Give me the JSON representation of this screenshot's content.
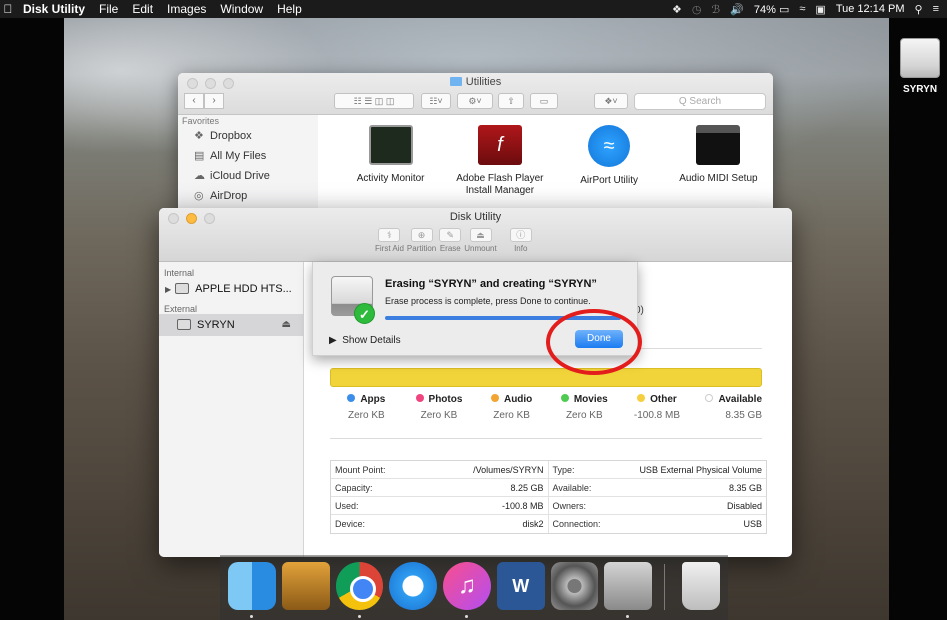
{
  "menubar": {
    "app_name": "Disk Utility",
    "menus": [
      "File",
      "Edit",
      "Images",
      "Window",
      "Help"
    ],
    "battery": "74%",
    "clock": "Tue 12:14 PM"
  },
  "desktop": {
    "drive_label": "SYRYN"
  },
  "finder": {
    "title": "Utilities",
    "search_placeholder": "Q Search",
    "sidebar_header": "Favorites",
    "sidebar_items": [
      "Dropbox",
      "All My Files",
      "iCloud Drive",
      "AirDrop"
    ],
    "apps": [
      {
        "name": "Activity Monitor"
      },
      {
        "name": "Adobe Flash Player Install Manager"
      },
      {
        "name": "AirPort Utility"
      },
      {
        "name": "Audio MIDI Setup"
      }
    ]
  },
  "disk_utility": {
    "title": "Disk Utility",
    "toolbar": [
      "First Aid",
      "Partition",
      "Erase",
      "Unmount",
      "Info"
    ],
    "sidebar": {
      "internal_header": "Internal",
      "internal_device": "APPLE HDD HTS...",
      "external_header": "External",
      "external_device": "SYRYN"
    },
    "legend": [
      {
        "name": "Apps",
        "value": "Zero KB",
        "color": "#3b8eea"
      },
      {
        "name": "Photos",
        "value": "Zero KB",
        "color": "#f0457f"
      },
      {
        "name": "Audio",
        "value": "Zero KB",
        "color": "#f3a531"
      },
      {
        "name": "Movies",
        "value": "Zero KB",
        "color": "#4fcb52"
      },
      {
        "name": "Other",
        "value": "-100.8 MB",
        "color": "#f6cf3e"
      },
      {
        "name": "Available",
        "value": "8.35 GB",
        "color": "#ffffff"
      }
    ],
    "info": {
      "mount_point_label": "Mount Point:",
      "mount_point": "/Volumes/SYRYN",
      "type_label": "Type:",
      "type": "USB External Physical Volume",
      "capacity_label": "Capacity:",
      "capacity": "8.25 GB",
      "available_label": "Available:",
      "available": "8.35 GB",
      "used_label": "Used:",
      "used": "-100.8 MB",
      "owners_label": "Owners:",
      "owners": "Disabled",
      "device_label": "Device:",
      "device": "disk2",
      "connection_label": "Connection:",
      "connection": "USB"
    },
    "partial_text": "0)"
  },
  "erase_sheet": {
    "title": "Erasing “SYRYN” and creating “SYRYN”",
    "message": "Erase process is complete, press Done to continue.",
    "progress": 1.0,
    "details_label": "Show Details",
    "done_label": "Done"
  },
  "dock": [
    "Finder",
    "Calculator",
    "Chrome",
    "Safari",
    "iTunes",
    "Word",
    "System Preferences",
    "Disk Utility",
    "Trash"
  ]
}
